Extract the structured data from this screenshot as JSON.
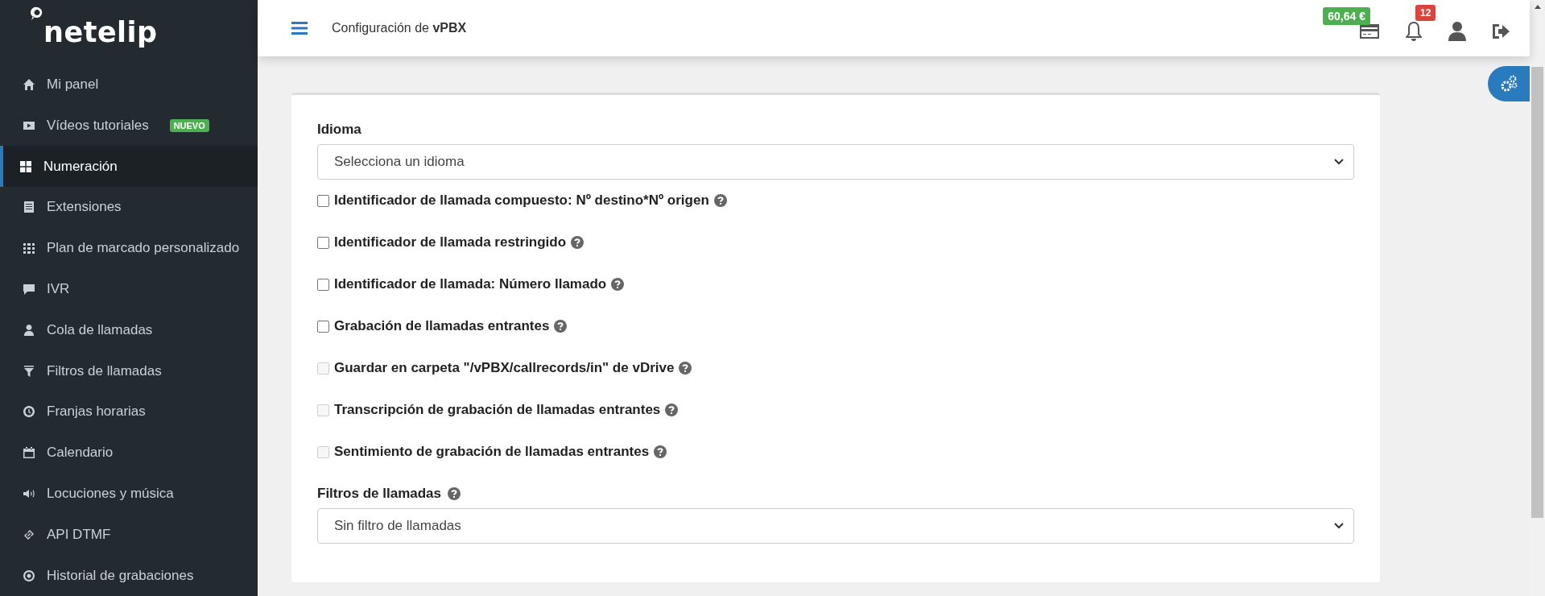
{
  "sidebar": {
    "brand": "netelip",
    "items": [
      {
        "label": "Mi panel",
        "selected": false
      },
      {
        "label": "Vídeos tutoriales",
        "selected": false,
        "badge": "NUEVO"
      },
      {
        "label": "Numeración",
        "selected": true
      },
      {
        "label": "Extensiones",
        "selected": false
      },
      {
        "label": "Plan de marcado personalizado",
        "selected": false
      },
      {
        "label": "IVR",
        "selected": false
      },
      {
        "label": "Cola de llamadas",
        "selected": false
      },
      {
        "label": "Filtros de llamadas",
        "selected": false
      },
      {
        "label": "Franjas horarias",
        "selected": false
      },
      {
        "label": "Calendario",
        "selected": false
      },
      {
        "label": "Locuciones y música",
        "selected": false
      },
      {
        "label": "API DTMF",
        "selected": false
      },
      {
        "label": "Historial de grabaciones",
        "selected": false
      }
    ]
  },
  "header": {
    "title": "Configuración de **vPBX**",
    "balance": "60,64 €",
    "notifications": "12"
  },
  "form": {
    "language": {
      "label": "Idioma",
      "value": "Selecciona un idioma"
    },
    "options": [
      {
        "label": "Identificador de llamada compuesto: Nº destino*Nº origen",
        "checked": false,
        "disabled": false
      },
      {
        "label": "Identificador de llamada restringido",
        "checked": false,
        "disabled": false
      },
      {
        "label": "Identificador de llamada: Número llamado",
        "checked": false,
        "disabled": false
      },
      {
        "label": "Grabación de llamadas entrantes",
        "checked": false,
        "disabled": false
      },
      {
        "label": "Guardar en carpeta \"/vPBX/callrecords/in\" de vDrive",
        "checked": false,
        "disabled": true
      },
      {
        "label": "Transcripción de grabación de llamadas entrantes",
        "checked": false,
        "disabled": true
      },
      {
        "label": "Sentimiento de grabación de llamadas entrantes",
        "checked": false,
        "disabled": true
      }
    ],
    "filter": {
      "label": "Filtros de llamadas",
      "value": "Sin filtro de llamadas"
    }
  }
}
